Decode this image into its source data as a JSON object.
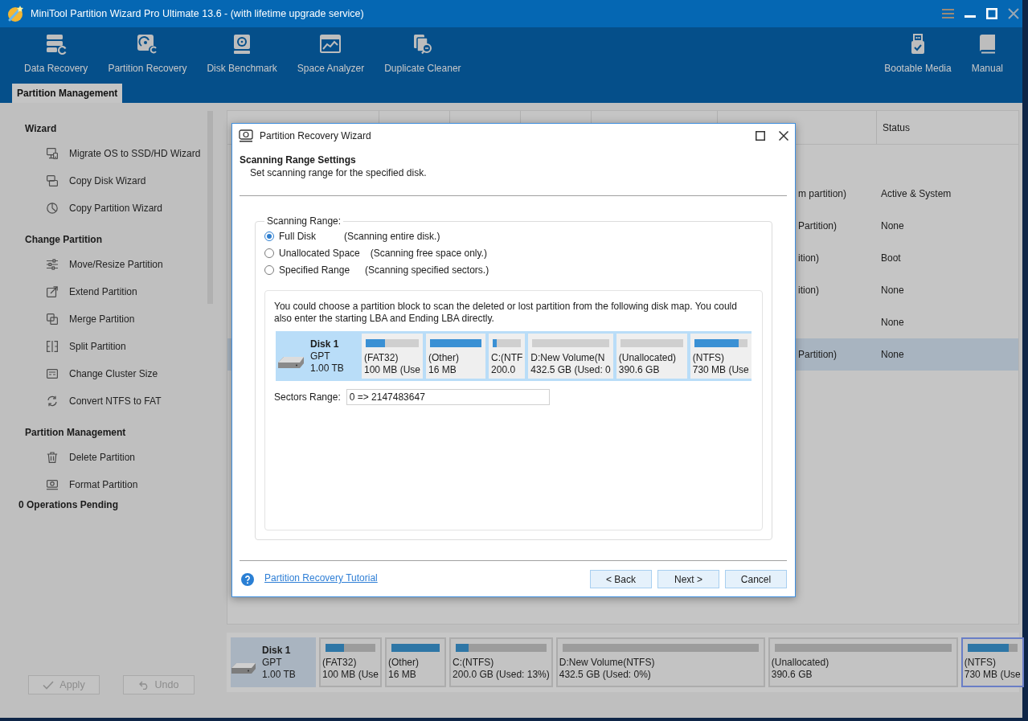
{
  "window": {
    "title": "MiniTool Partition Wizard Pro Ultimate 13.6 - (with lifetime upgrade service)"
  },
  "toolbar": {
    "left": [
      "Data Recovery",
      "Partition Recovery",
      "Disk Benchmark",
      "Space Analyzer",
      "Duplicate Cleaner"
    ],
    "right": [
      "Bootable Media",
      "Manual"
    ]
  },
  "tabs": [
    {
      "label": "Partition Management",
      "selected": true
    }
  ],
  "sidebar": {
    "sections": [
      {
        "title": "Wizard",
        "items": [
          "Migrate OS to SSD/HD Wizard",
          "Copy Disk Wizard",
          "Copy Partition Wizard"
        ]
      },
      {
        "title": "Change Partition",
        "items": [
          "Move/Resize Partition",
          "Extend Partition",
          "Merge Partition",
          "Split Partition",
          "Change Cluster Size",
          "Convert NTFS to FAT"
        ]
      },
      {
        "title": "Partition Management",
        "items": [
          "Delete Partition",
          "Format Partition"
        ]
      }
    ],
    "pending": "0 Operations Pending",
    "buttons": [
      {
        "label": "Apply",
        "disabled": true
      },
      {
        "label": "Undo",
        "disabled": true
      }
    ]
  },
  "table": {
    "status_header": "Status",
    "rows": [
      {
        "column_6": "m partition)",
        "status": "Active & System",
        "selected": false
      },
      {
        "column_6": "Partition)",
        "status": "None",
        "selected": false
      },
      {
        "column_6": "ition)",
        "status": "Boot",
        "selected": false
      },
      {
        "column_6": "ition)",
        "status": "None",
        "selected": false
      },
      {
        "status": "None",
        "selected": false
      },
      {
        "column_6": "Partition)",
        "status": "None",
        "selected": true
      }
    ]
  },
  "disk_map": {
    "disk": {
      "name": "Disk 1",
      "type": "GPT",
      "size": "1.00 TB"
    },
    "partitions": [
      {
        "label": "(FAT32)",
        "size": "100 MB (Use",
        "level": 0.37,
        "selected": false
      },
      {
        "label": "(Other)",
        "size": "16 MB",
        "level": 1,
        "selected": false
      },
      {
        "label": "C:(NTFS)",
        "size": "200.0 GB (Used: 13%)",
        "level": 0.14,
        "selected": false
      },
      {
        "label": "D:New Volume(NTFS)",
        "size": "432.5 GB (Used: 0%)",
        "selected": false
      },
      {
        "label": "(Unallocated)",
        "size": "390.6 GB",
        "selected": false
      },
      {
        "label": "(NTFS)",
        "size": "730 MB (Use",
        "level": 0.82,
        "selected": true
      }
    ]
  },
  "dialog": {
    "title": "Partition Recovery Wizard",
    "heading": "Scanning Range Settings",
    "subheading": "Set scanning range for the specified disk.",
    "group_label": "Scanning Range:",
    "options": [
      {
        "label": "Full Disk",
        "description": "(Scanning entire disk.)",
        "selected": true
      },
      {
        "label": "Unallocated Space",
        "description": "(Scanning free space only.)",
        "selected": false
      },
      {
        "label": "Specified Range",
        "description": "(Scanning specified sectors.)",
        "selected": false
      }
    ],
    "hint": "You could choose a partition block to scan the deleted or lost partition from the following disk map. You could also enter the starting LBA and Ending LBA directly.",
    "disk_map": {
      "selected": true,
      "disk": {
        "name": "Disk 1",
        "type": "GPT",
        "size": "1.00 TB"
      },
      "partitions": [
        {
          "label": "(FAT32)",
          "size": "100 MB (Use",
          "level": 0.36
        },
        {
          "label": "(Other)",
          "size": "16 MB",
          "level": 1
        },
        {
          "label": "C:(NTF",
          "size": "200.0",
          "level": 0.15
        },
        {
          "label": "D:New Volume(N",
          "size": "432.5 GB (Used: 0"
        },
        {
          "label": "(Unallocated)",
          "size": "390.6 GB"
        },
        {
          "label": "(NTFS)",
          "size": "730 MB (Use",
          "level": 0.84
        }
      ]
    },
    "sectors_range": {
      "label": "Sectors Range:",
      "value": "0 => 2147483647"
    },
    "help_link": "Partition Recovery Tutorial",
    "buttons": [
      "< Back",
      "Next >",
      "Cancel"
    ]
  }
}
